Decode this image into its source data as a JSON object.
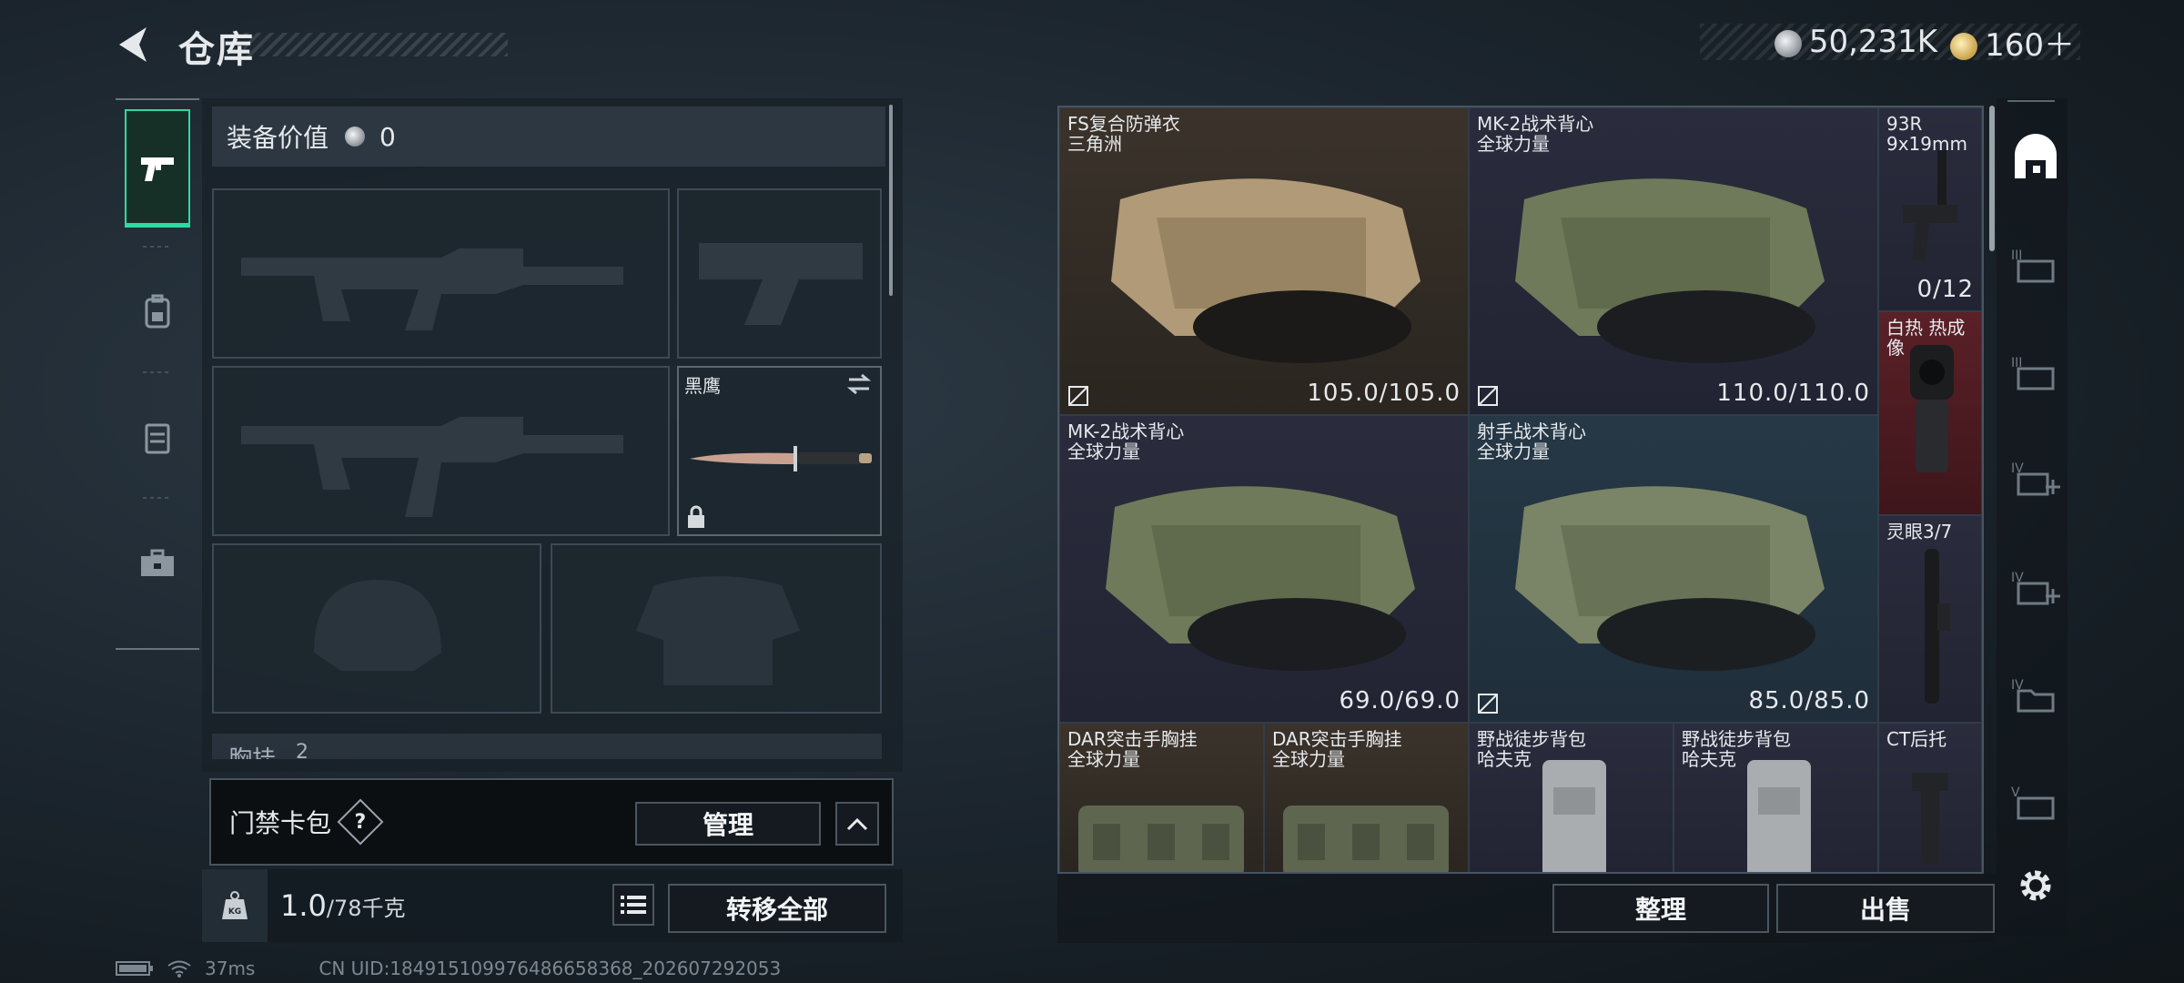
{
  "header": {
    "title": "仓库"
  },
  "currency": {
    "silver": "50,231K",
    "gold": "160＋"
  },
  "equipment": {
    "value_label": "装备价值",
    "value": "0",
    "melee_name": "黑鹰",
    "rig_label_partial": "胸挂",
    "rig_count_partial": "2"
  },
  "card_pack": {
    "label": "门禁卡包",
    "help": "?",
    "manage_label": "管理"
  },
  "weight": {
    "current": "1.0",
    "max": "/78千克",
    "transfer_label": "转移全部",
    "kg_icon_text": "KG"
  },
  "storage": {
    "items": [
      {
        "name": "FS复合防弹衣",
        "sub": "三角洲",
        "durability": "105.0/105.0"
      },
      {
        "name": "MK-2战术背心",
        "sub": "全球力量",
        "durability": "110.0/110.0"
      },
      {
        "name": "93R",
        "sub": "9x19mm",
        "durability": "0/12"
      },
      {
        "name": "白热 热成像",
        "sub": "",
        "durability": ""
      },
      {
        "name": "MK-2战术背心",
        "sub": "全球力量",
        "durability": "69.0/69.0"
      },
      {
        "name": "射手战术背心",
        "sub": "全球力量",
        "durability": "85.0/85.0"
      },
      {
        "name": "灵眼3/7",
        "sub": "",
        "durability": ""
      },
      {
        "name": "DAR突击手胸挂",
        "sub": "全球力量",
        "durability": ""
      },
      {
        "name": "DAR突击手胸挂",
        "sub": "全球力量",
        "durability": ""
      },
      {
        "name": "野战徒步背包",
        "sub": "哈夫克",
        "durability": ""
      },
      {
        "name": "野战徒步背包",
        "sub": "哈夫克",
        "durability": ""
      },
      {
        "name": "CT后托",
        "sub": "",
        "durability": ""
      }
    ]
  },
  "actions": {
    "sort_label": "整理",
    "sell_label": "出售"
  },
  "status": {
    "ping": "37ms",
    "uid": "CN UID:184915109976486658368_202607292053"
  },
  "colors": {
    "accent": "#2fd9a2",
    "cell_brown": "#3b332b",
    "cell_purple": "#2a2c3d",
    "cell_teal": "#263846",
    "cell_red": "#5a2027"
  },
  "icons": [
    "back-arrow-icon",
    "pistol-icon",
    "backpack-icon",
    "vest-icon",
    "toolbox-icon",
    "silver-coin-icon",
    "gold-coin-icon",
    "list-icon",
    "kg-weight-icon",
    "swap-icon",
    "lock-icon",
    "no-drop-icon",
    "gear-icon",
    "chevron-up-icon"
  ]
}
